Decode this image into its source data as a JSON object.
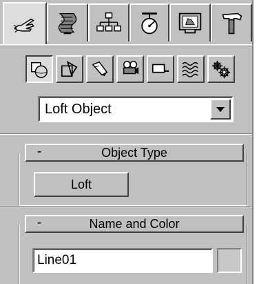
{
  "tabs": [
    {
      "id": "create",
      "icon": "create-hand-icon",
      "active": true
    },
    {
      "id": "modify",
      "icon": "modify-bend-icon",
      "active": false
    },
    {
      "id": "hierarchy",
      "icon": "hierarchy-tree-icon",
      "active": false
    },
    {
      "id": "motion",
      "icon": "motion-wheel-icon",
      "active": false
    },
    {
      "id": "display",
      "icon": "display-monitor-icon",
      "active": false
    },
    {
      "id": "utilities",
      "icon": "utilities-hammer-icon",
      "active": false
    }
  ],
  "tools": [
    {
      "id": "geometry",
      "icon": "geometry-sphere-icon",
      "pressed": true
    },
    {
      "id": "shapes",
      "icon": "shapes-icon",
      "pressed": false
    },
    {
      "id": "lights",
      "icon": "lights-spotlight-icon",
      "pressed": false
    },
    {
      "id": "cameras",
      "icon": "cameras-icon",
      "pressed": false
    },
    {
      "id": "helpers",
      "icon": "helpers-tape-icon",
      "pressed": false
    },
    {
      "id": "space-warps",
      "icon": "space-warps-icon",
      "pressed": false
    },
    {
      "id": "systems",
      "icon": "systems-gears-icon",
      "pressed": false
    }
  ],
  "category_dropdown": {
    "selected": "Loft Object"
  },
  "object_type": {
    "toggle": "-",
    "title": "Object Type",
    "button_label": "Loft"
  },
  "name_and_color": {
    "toggle": "-",
    "title": "Name and Color",
    "name_value": "Line01",
    "swatch_color": "#c8c8c8"
  },
  "colors": {
    "panel": "#c0c0c0",
    "highlight": "#ffffff",
    "shadow": "#404040",
    "mid_shadow": "#808080"
  }
}
